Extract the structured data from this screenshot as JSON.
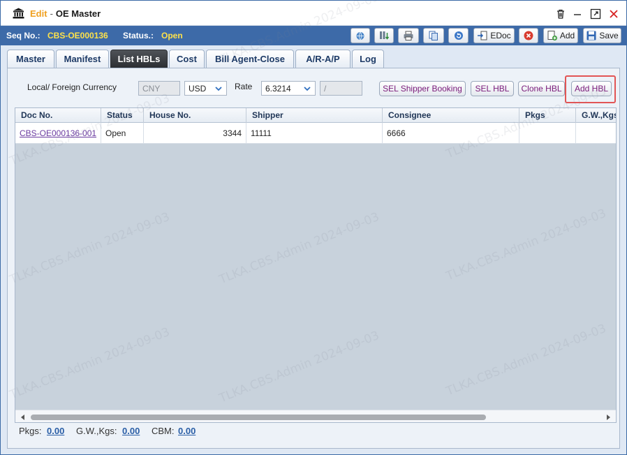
{
  "window": {
    "mode_label": "Edit",
    "title": "OE Master"
  },
  "header": {
    "seq_label": "Seq No.:",
    "seq_value": "CBS-OE000136",
    "status_label": "Status.:",
    "status_value": "Open",
    "buttons": {
      "edoc_label": "EDoc",
      "add_label": "Add",
      "save_label": "Save"
    }
  },
  "tabs": [
    {
      "label": "Master"
    },
    {
      "label": "Manifest"
    },
    {
      "label": "List HBLs"
    },
    {
      "label": "Cost"
    },
    {
      "label": "Bill Agent-Close"
    },
    {
      "label": "A/R-A/P"
    },
    {
      "label": "Log"
    }
  ],
  "form": {
    "currency_label": "Local/ Foreign Currency",
    "local_currency": "CNY",
    "foreign_currency": "USD",
    "rate_label": "Rate",
    "rate_value": "6.3214",
    "rate_extra": "/",
    "actions": {
      "sel_shipper_booking": "SEL Shipper Booking",
      "sel_hbl": "SEL HBL",
      "clone_hbl": "Clone HBL",
      "add_hbl": "Add HBL"
    }
  },
  "grid": {
    "columns": [
      "Doc No.",
      "Status",
      "House No.",
      "Shipper",
      "Consignee",
      "Pkgs",
      "G.W.,Kgs"
    ],
    "rows": [
      {
        "doc_no": "CBS-OE000136-001",
        "status": "Open",
        "house_no": "3344",
        "shipper": "11111",
        "consignee": "6666",
        "pkgs": "",
        "gw": ""
      }
    ]
  },
  "footer": {
    "pkgs_label": "Pkgs:",
    "pkgs_value": "0.00",
    "gw_label": "G.W.,Kgs:",
    "gw_value": "0.00",
    "cbm_label": "CBM:",
    "cbm_value": "0.00"
  },
  "watermark": "TLKA.CBS.Admin 2024-09-03",
  "colors": {
    "accent": "#3d6aa8",
    "status_value": "#ffe24a",
    "mode_label": "#f0a020",
    "action_text": "#7a1a7a",
    "highlight": "#e25555",
    "footer_value": "#2a5ea6"
  }
}
